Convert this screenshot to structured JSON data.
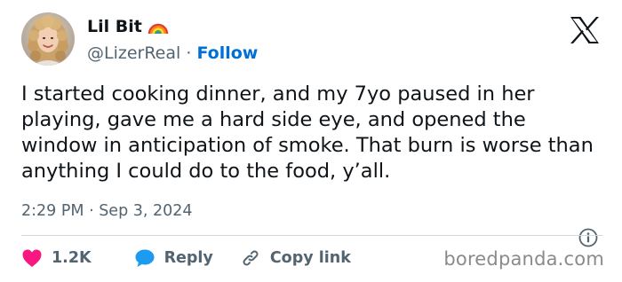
{
  "author": {
    "display_name": "Lil Bit",
    "badge_emoji_icon": "rainbow-icon",
    "handle": "@LizerReal",
    "separator": " · ",
    "follow_label": "Follow"
  },
  "brand_icon": "x-logo-icon",
  "tweet": {
    "text": "I started cooking dinner, and my 7yo paused in her playing, gave me a hard side eye, and opened the window in anticipation of smoke. That burn is worse than anything I could do to the food, y’all.",
    "timestamp": "2:29 PM · Sep 3, 2024"
  },
  "actions": {
    "like_count": "1.2K",
    "reply_label": "Reply",
    "copy_link_label": "Copy link"
  },
  "watermark": "boredpanda.com",
  "colors": {
    "like": "#f91880",
    "reply": "#1d9bf0",
    "follow": "#006fd6",
    "secondary_text": "#536471"
  }
}
